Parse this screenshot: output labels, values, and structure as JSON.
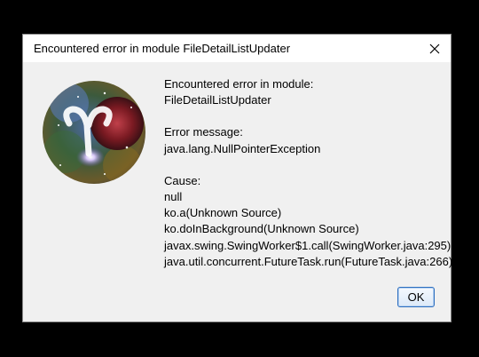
{
  "window": {
    "title": "Encountered error in module FileDetailListUpdater",
    "close_icon": "close-icon"
  },
  "logo": {
    "icon": "aries-nebula-logo"
  },
  "message": {
    "line1": "Encountered error in module:",
    "line2": "FileDetailListUpdater",
    "error_label": "Error message:",
    "error_value": "java.lang.NullPointerException",
    "cause_label": "Cause:",
    "cause_lines": [
      "null",
      "ko.a(Unknown Source)",
      "ko.doInBackground(Unknown Source)",
      "javax.swing.SwingWorker$1.call(SwingWorker.java:295)",
      "java.util.concurrent.FutureTask.run(FutureTask.java:266)"
    ]
  },
  "buttons": {
    "ok_label": "OK"
  }
}
